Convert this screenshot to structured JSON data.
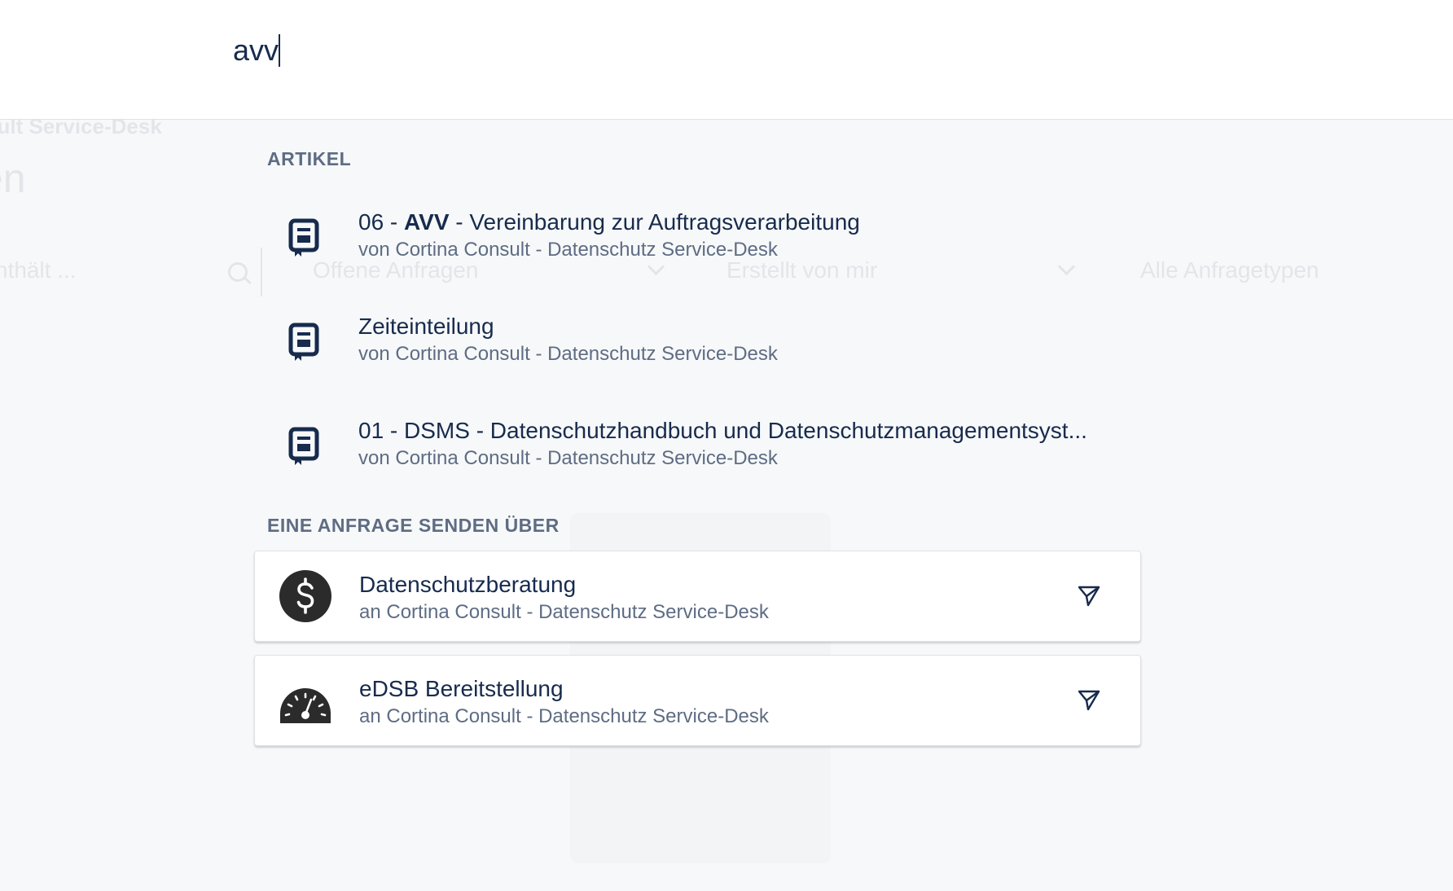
{
  "background": {
    "breadcrumb": "sult Service-Desk",
    "title": "en",
    "search_placeholder": "nthält ...",
    "filter_status": "Offene Anfragen",
    "filter_creator": "Erstellt von mir",
    "filter_types": "Alle Anfragetypen"
  },
  "search": {
    "value": "avv"
  },
  "articles_section": {
    "heading": "ARTIKEL",
    "items": [
      {
        "title_prefix": "06 - ",
        "title_match": "AVV",
        "title_suffix": " - Vereinbarung zur Auftragsverarbeitung",
        "subtitle": "von Cortina Consult - Datenschutz Service-Desk",
        "icon": "knowledge-article-icon"
      },
      {
        "title": "Zeiteinteilung",
        "subtitle": "von Cortina Consult - Datenschutz Service-Desk",
        "icon": "knowledge-article-icon"
      },
      {
        "title": "01 - DSMS - Datenschutzhandbuch und Datenschutzmanagementsyst...",
        "subtitle": "von Cortina Consult - Datenschutz Service-Desk",
        "icon": "knowledge-article-icon"
      }
    ]
  },
  "requests_section": {
    "heading": "EINE ANFRAGE SENDEN ÜBER",
    "items": [
      {
        "title": "Datenschutzberatung",
        "subtitle": "an Cortina Consult - Datenschutz Service-Desk",
        "icon": "dollar-icon"
      },
      {
        "title": "eDSB Bereitstellung",
        "subtitle": "an Cortina Consult - Datenschutz Service-Desk",
        "icon": "speedometer-icon"
      }
    ]
  },
  "colors": {
    "text_primary": "#172b4d",
    "text_secondary": "#5e6c84",
    "icon_dark": "#2b2b2b",
    "background": "#f7f8f9"
  }
}
